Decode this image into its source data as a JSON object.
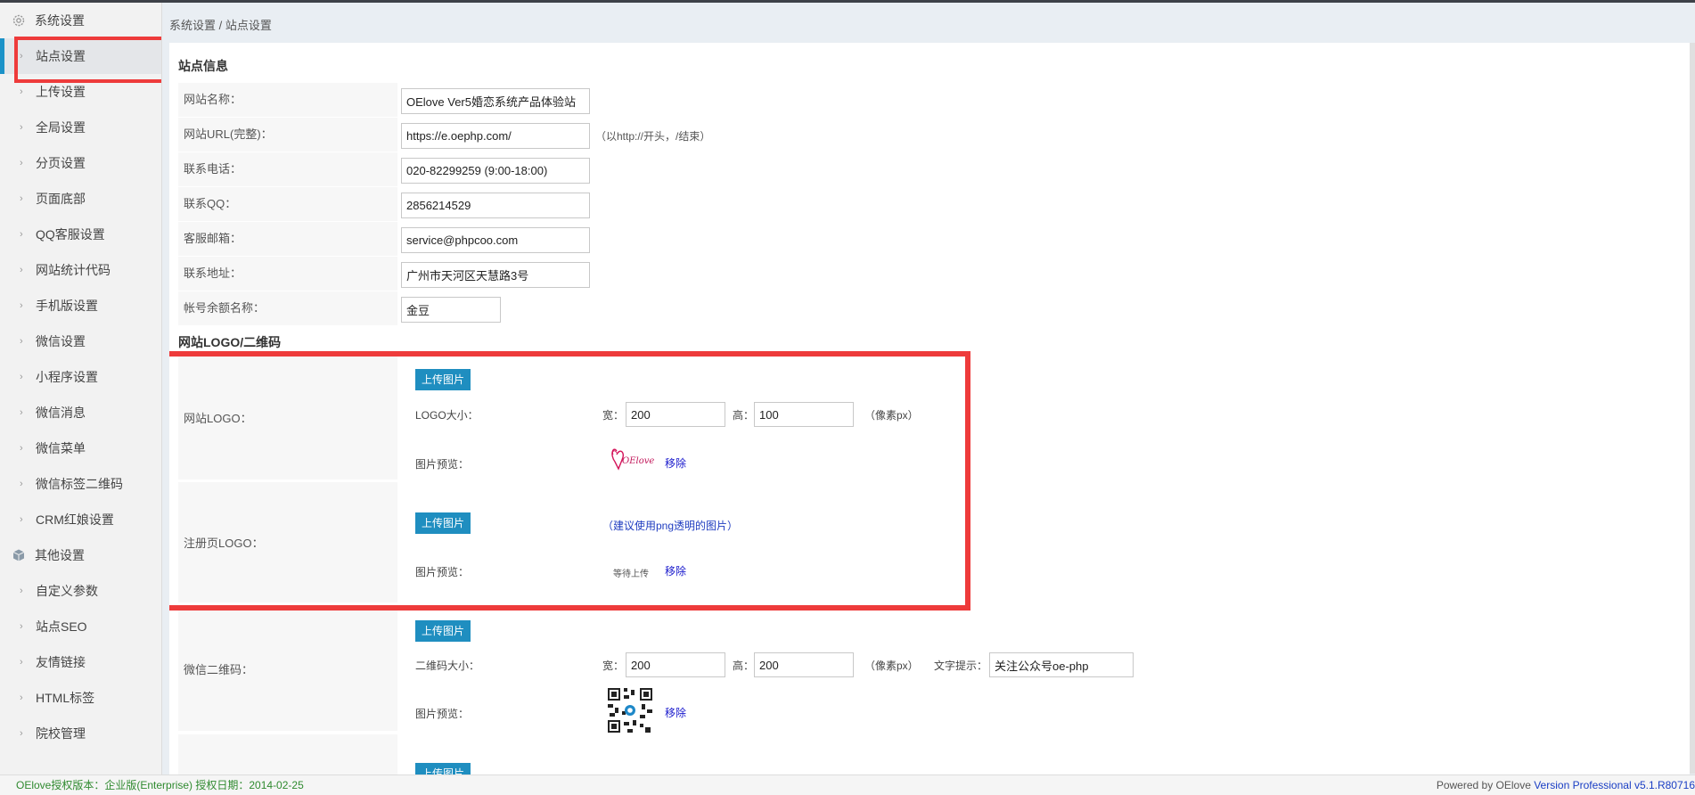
{
  "breadcrumb": "系统设置 / 站点设置",
  "sidebar": {
    "group1": "系统设置",
    "items1": [
      "站点设置",
      "上传设置",
      "全局设置",
      "分页设置",
      "页面底部",
      "QQ客服设置",
      "网站统计代码",
      "手机版设置",
      "微信设置",
      "小程序设置",
      "微信消息",
      "微信菜单",
      "微信标签二维码",
      "CRM红娘设置"
    ],
    "group2": "其他设置",
    "items2": [
      "自定义参数",
      "站点SEO",
      "友情链接",
      "HTML标签",
      "院校管理"
    ]
  },
  "site_info": {
    "title": "站点信息",
    "site_name_label": "网站名称：",
    "site_name": "OElove Ver5婚恋系统产品体验站",
    "site_url_label": "网站URL(完整)：",
    "site_url": "https://e.oephp.com/",
    "site_url_hint": "（以http://开头，/结束）",
    "phone_label": "联系电话：",
    "phone": "020-82299259 (9:00-18:00)",
    "qq_label": "联系QQ：",
    "qq": "2856214529",
    "email_label": "客服邮箱：",
    "email": "service@phpcoo.com",
    "address_label": "联系地址：",
    "address": "广州市天河区天慧路3号",
    "balance_label": "帐号余额名称：",
    "balance": "金豆"
  },
  "logo_section": {
    "title": "网站LOGO/二维码",
    "upload_label": "上传图片",
    "remove_label": "移除",
    "preview_label": "图片预览：",
    "width_label": "宽：",
    "height_label": "高：",
    "unit_hint": "（像素px）",
    "site_logo": {
      "label": "网站LOGO：",
      "size_label": "LOGO大小：",
      "width": "200",
      "height": "100",
      "logo_text": "OElove"
    },
    "reg_logo": {
      "label": "注册页LOGO：",
      "hint": "（建议使用png透明的图片）",
      "waiting": "等待上传"
    },
    "wechat_qr": {
      "label": "微信二维码：",
      "size_label": "二维码大小：",
      "width": "200",
      "height": "200",
      "text_tip_label": "文字提示：",
      "text_tip": "关注公众号oe-php"
    }
  },
  "footer": {
    "left": "OElove授权版本：企业版(Enterprise) 授权日期：2014-02-25",
    "right_prefix": "Powered by OElove ",
    "version": "Version Professional v5.1.R80716"
  },
  "colors": {
    "accent": "#1f8ec0",
    "highlight": "#ee3b3b"
  }
}
